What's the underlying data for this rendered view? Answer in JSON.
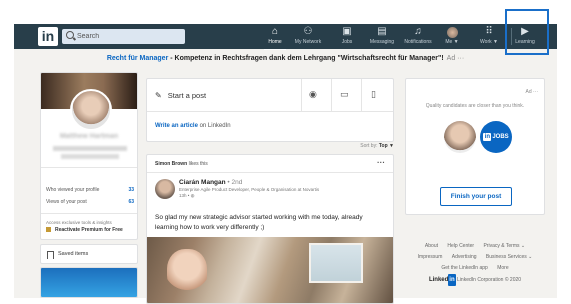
{
  "nav": {
    "logo": "in",
    "search_placeholder": "Search",
    "items": [
      {
        "label": "Home",
        "icon": "home-icon"
      },
      {
        "label": "My Network",
        "icon": "network-icon"
      },
      {
        "label": "Jobs",
        "icon": "briefcase-icon"
      },
      {
        "label": "Messaging",
        "icon": "messaging-icon"
      },
      {
        "label": "Notifications",
        "icon": "bell-icon"
      },
      {
        "label": "Me ▼",
        "icon": "avatar"
      },
      {
        "label": "Work ▼",
        "icon": "grid-icon"
      },
      {
        "label": "Learning",
        "icon": "learning-icon"
      }
    ],
    "highlight_color": "#1a6fc9"
  },
  "promo": {
    "link": "Recht für Manager",
    "rest": " - Kompetenz in Rechtsfragen dank dem Lehrgang \"Wirtschaftsrecht für Manager\"!",
    "ad": "Ad  ···"
  },
  "left": {
    "name": "Matthew Hartman",
    "stats": [
      {
        "label": "Who viewed your profile",
        "value": "33"
      },
      {
        "label": "Views of your post",
        "value": "63"
      }
    ],
    "premium_note": "Access exclusive tools & insights",
    "premium_link": "Reactivate Premium for Free",
    "saved_items": "Saved items"
  },
  "share": {
    "start_post": "Start a post",
    "write_article_link": "Write an article",
    "write_article_rest": " on LinkedIn"
  },
  "sort": {
    "prefix": "Sort by: ",
    "value": "Top ▼"
  },
  "post": {
    "liker": "Simon Brown",
    "liker_action": " likes this",
    "author": "Ciarán Mangan",
    "degree": " • 2nd",
    "role": "Enterprise Agile Product Developer, People & Organisation at Novartis",
    "time": "13h • ◍",
    "text": "So glad my new strategic advisor started working with me today, already learning how to work very differently ;)"
  },
  "right": {
    "ad": "Ad  ···",
    "note": "Quality candidates are closer than you think.",
    "jobs_logo": "in",
    "jobs_text": "JOBS",
    "button": "Finish your post"
  },
  "footer": {
    "row1": [
      "About",
      "Help Center",
      "Privacy & Terms ⌄"
    ],
    "row2": [
      "Impressum",
      "Advertising",
      "Business Services ⌄"
    ],
    "row3": [
      "Get the LinkedIn app",
      "More"
    ],
    "brand": "Linked",
    "brand_in": "in",
    "copy": " LinkedIn Corporation © 2020"
  }
}
